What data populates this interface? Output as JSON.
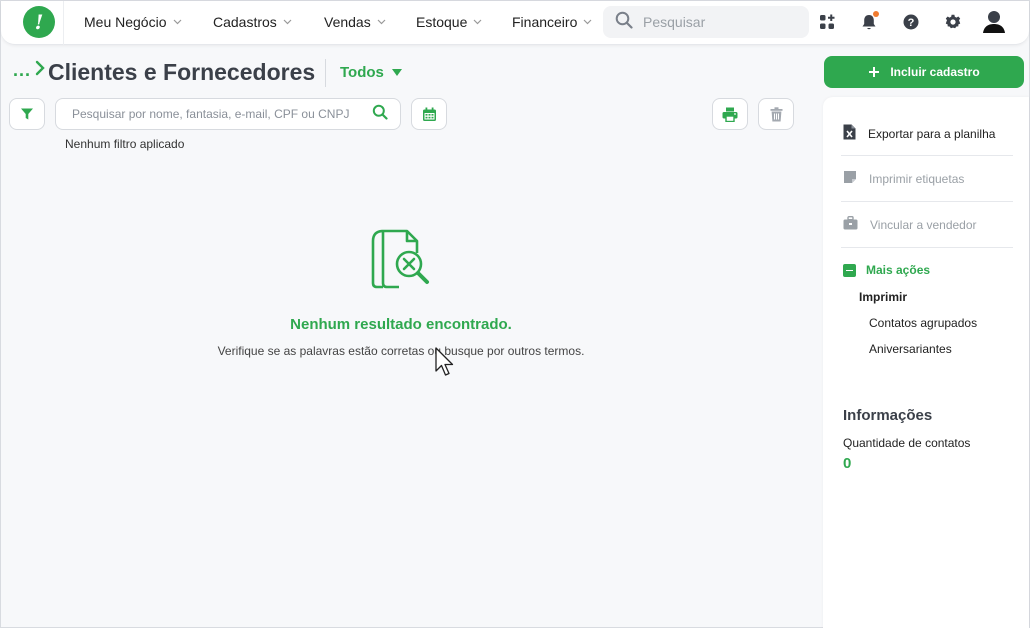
{
  "topbar": {
    "logo_char": "!",
    "nav": [
      {
        "label": "Meu Negócio"
      },
      {
        "label": "Cadastros"
      },
      {
        "label": "Vendas"
      },
      {
        "label": "Estoque"
      },
      {
        "label": "Financeiro"
      }
    ],
    "search_placeholder": "Pesquisar",
    "icons": [
      "apps-icon",
      "bell-icon",
      "help-icon",
      "gear-icon",
      "user-avatar-icon"
    ]
  },
  "header": {
    "breadcrumb_dots": "...",
    "title": "Clientes e Fornecedores",
    "filter_label": "Todos"
  },
  "toolbar": {
    "search_placeholder": "Pesquisar por nome, fantasia, e-mail, CPF ou CNPJ",
    "search_value": "",
    "no_filter_text": "Nenhum filtro aplicado"
  },
  "empty_state": {
    "title": "Nenhum resultado encontrado.",
    "subtitle": "Verifique se as palavras estão corretas ou busque por outros termos."
  },
  "side": {
    "add_button": "Incluir cadastro",
    "actions": [
      {
        "label": "Exportar para a planilha",
        "enabled": true
      },
      {
        "label": "Imprimir etiquetas",
        "enabled": false
      },
      {
        "label": "Vincular a vendedor",
        "enabled": false
      }
    ],
    "more_actions": "Mais ações",
    "print_heading": "Imprimir",
    "print_links": [
      "Contatos agrupados",
      "Aniversariantes"
    ],
    "info_title": "Informações",
    "info_label": "Quantidade de contatos",
    "info_value": "0"
  },
  "colors": {
    "brand": "#2fa84f",
    "title": "#3b4049",
    "disabled": "#9aa0a6",
    "notification": "#f07b2f"
  }
}
